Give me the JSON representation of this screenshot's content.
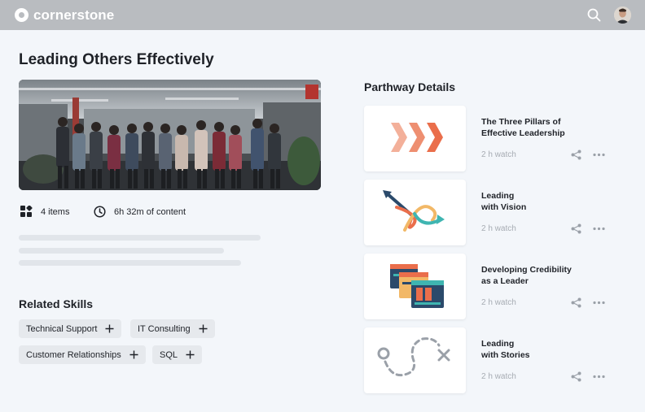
{
  "brand": {
    "name": "cornerstone"
  },
  "course": {
    "title": "Leading Others Effectively",
    "items": "4 items",
    "duration": "6h 32m of content"
  },
  "related_skills": {
    "title": "Related Skills",
    "chips": [
      {
        "label": "Technical Support"
      },
      {
        "label": "IT Consulting"
      },
      {
        "label": "Customer Relationships"
      },
      {
        "label": "SQL"
      }
    ]
  },
  "parthway": {
    "title": "Parthway Details",
    "cards": [
      {
        "line1": "The Three Pillars of",
        "line2": "Effective Leadership",
        "duration": "2 h watch",
        "icon": "chevrons-icon"
      },
      {
        "line1": "Leading",
        "line2": "with Vision",
        "duration": "2 h watch",
        "icon": "arrows-icon"
      },
      {
        "line1": "Developing Credibility",
        "line2": "as a Leader",
        "duration": "2 h watch",
        "icon": "windows-icon"
      },
      {
        "line1": "Leading",
        "line2": "with Stories",
        "duration": "2 h watch",
        "icon": "path-icon"
      }
    ]
  },
  "colors": {
    "topbar": "#b9bcc0",
    "accent_orange": "#ee7a55",
    "accent_teal": "#3fb5b1",
    "accent_navy": "#2b4a6b"
  }
}
